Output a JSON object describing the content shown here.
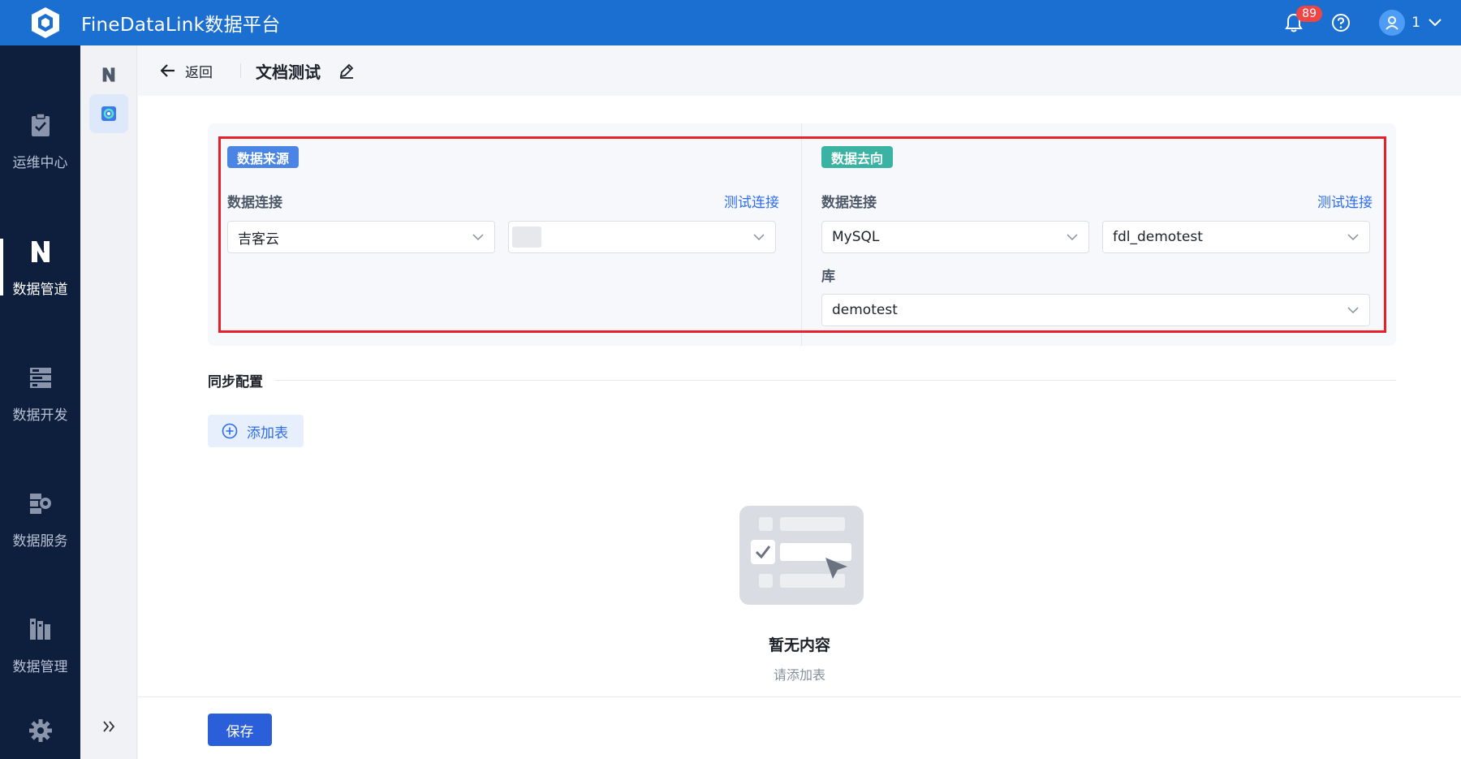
{
  "app": {
    "title": "FineDataLink数据平台"
  },
  "topbar": {
    "notification_count": "89",
    "user_name": "1"
  },
  "nav": {
    "items": [
      {
        "label": "运维中心",
        "icon": "clipboard-check-icon",
        "active": false
      },
      {
        "label": "数据管道",
        "icon": "pipeline-icon",
        "active": true
      },
      {
        "label": "数据开发",
        "icon": "server-stack-icon",
        "active": false
      },
      {
        "label": "数据服务",
        "icon": "service-icon",
        "active": false
      },
      {
        "label": "数据管理",
        "icon": "books-icon",
        "active": false
      }
    ]
  },
  "header": {
    "back_label": "返回",
    "title": "文档测试"
  },
  "source": {
    "tag": "数据来源",
    "conn_label": "数据连接",
    "test_link": "测试连接",
    "conn_type": "吉客云",
    "conn_name": ""
  },
  "target": {
    "tag": "数据去向",
    "conn_label": "数据连接",
    "test_link": "测试连接",
    "conn_type": "MySQL",
    "conn_name": "fdl_demotest",
    "db_label": "库",
    "db_value": "demotest"
  },
  "sync": {
    "section_title": "同步配置",
    "add_table_label": "添加表"
  },
  "empty": {
    "title": "暂无内容",
    "subtitle": "请添加表"
  },
  "footer": {
    "save_label": "保存"
  },
  "colors": {
    "brand": "#1b6fd0",
    "nav_bg": "#0e1e3d",
    "primary": "#2b5fd9",
    "highlight_frame": "#e8202a",
    "source_tag": "#4a85e6",
    "target_tag": "#3bb3a3"
  }
}
